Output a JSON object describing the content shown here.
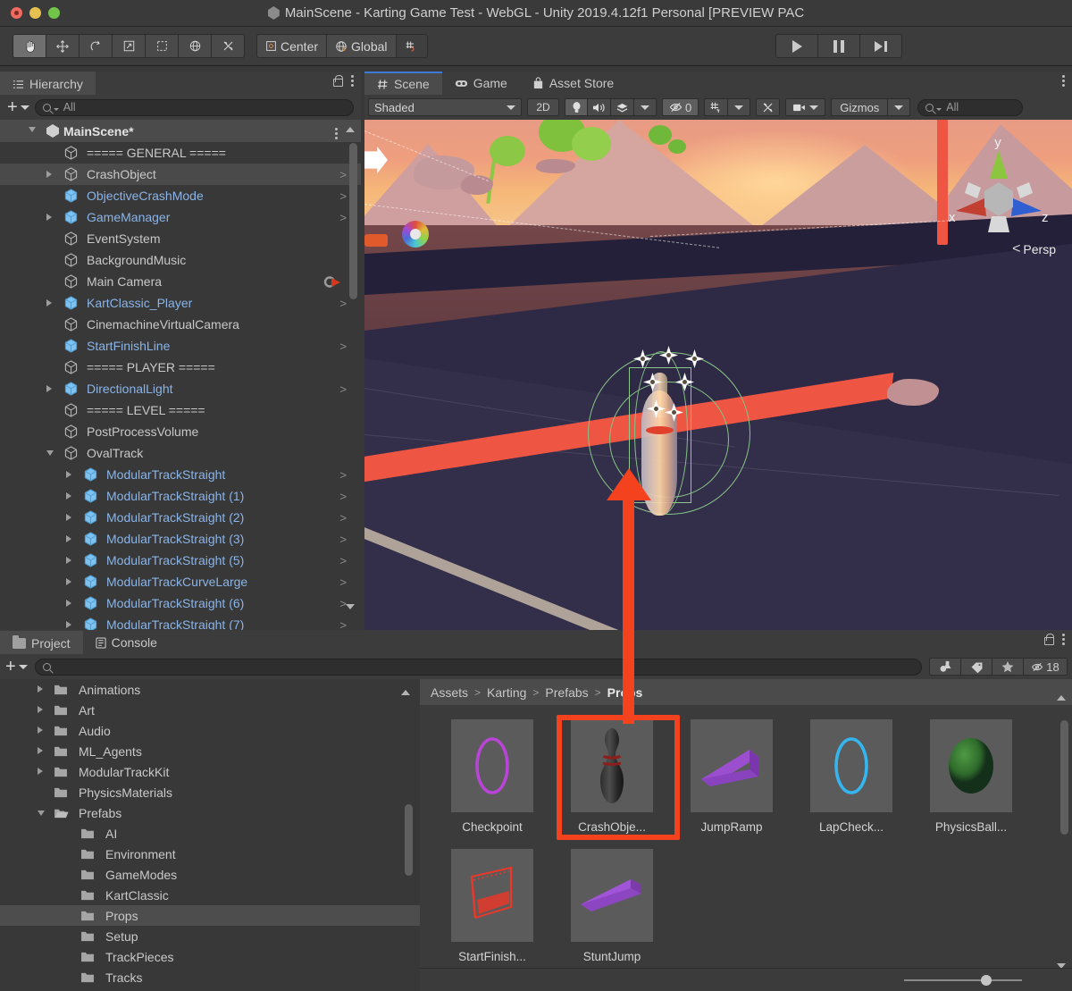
{
  "window": {
    "title": "MainScene - Karting Game Test - WebGL - Unity 2019.4.12f1 Personal [PREVIEW PAC",
    "traffic_close": "close-button",
    "traffic_minimize": "minimize-button",
    "traffic_zoom": "zoom-button"
  },
  "toolbar": {
    "tools": [
      {
        "name": "hand-tool",
        "glyph": "✋",
        "active": true
      },
      {
        "name": "move-tool",
        "glyph": "✥",
        "active": false
      },
      {
        "name": "rotate-tool",
        "glyph": "↻",
        "active": false
      },
      {
        "name": "scale-tool",
        "glyph": "⤡",
        "active": false
      },
      {
        "name": "rect-tool",
        "glyph": "⬚",
        "active": false
      },
      {
        "name": "transform-tool",
        "glyph": "✶",
        "active": false
      },
      {
        "name": "custom-tool",
        "glyph": "⚒",
        "active": false
      }
    ],
    "pivot_label": "Center",
    "handle_label": "Global",
    "grid_label": "grid-snap",
    "play_label": "play-button",
    "pause_label": "pause-button",
    "step_label": "step-button"
  },
  "hierarchy": {
    "tab_label": "Hierarchy",
    "search": {
      "value": "",
      "placeholder": "All"
    },
    "scene_name": "MainScene*",
    "items": [
      {
        "label": "===== GENERAL =====",
        "indent": 0,
        "prefab": false,
        "expandable": false,
        "chevron": false
      },
      {
        "label": "CrashObject",
        "indent": 0,
        "prefab": false,
        "expandable": true,
        "chevron": true,
        "selected": true
      },
      {
        "label": "ObjectiveCrashMode",
        "indent": 0,
        "prefab": true,
        "expandable": false,
        "chevron": true
      },
      {
        "label": "GameManager",
        "indent": 0,
        "prefab": true,
        "expandable": true,
        "chevron": true
      },
      {
        "label": "EventSystem",
        "indent": 0,
        "prefab": false,
        "expandable": false,
        "chevron": false
      },
      {
        "label": "BackgroundMusic",
        "indent": 0,
        "prefab": false,
        "expandable": false,
        "chevron": false
      },
      {
        "label": "Main Camera",
        "indent": 0,
        "prefab": false,
        "expandable": false,
        "chevron": false,
        "badge": true
      },
      {
        "label": "KartClassic_Player",
        "indent": 0,
        "prefab": true,
        "expandable": true,
        "chevron": true
      },
      {
        "label": "CinemachineVirtualCamera",
        "indent": 0,
        "prefab": false,
        "expandable": false,
        "chevron": false
      },
      {
        "label": "StartFinishLine",
        "indent": 0,
        "prefab": true,
        "expandable": false,
        "chevron": true
      },
      {
        "label": "===== PLAYER =====",
        "indent": 0,
        "prefab": false,
        "expandable": false,
        "chevron": false
      },
      {
        "label": "DirectionalLight",
        "indent": 0,
        "prefab": true,
        "expandable": true,
        "chevron": true
      },
      {
        "label": "===== LEVEL =====",
        "indent": 0,
        "prefab": false,
        "expandable": false,
        "chevron": false
      },
      {
        "label": "PostProcessVolume",
        "indent": 0,
        "prefab": false,
        "expandable": false,
        "chevron": false
      },
      {
        "label": "OvalTrack",
        "indent": 0,
        "prefab": false,
        "expandable": true,
        "expanded": true,
        "chevron": false
      },
      {
        "label": "ModularTrackStraight",
        "indent": 1,
        "prefab": true,
        "expandable": true,
        "chevron": true
      },
      {
        "label": "ModularTrackStraight (1)",
        "indent": 1,
        "prefab": true,
        "expandable": true,
        "chevron": true
      },
      {
        "label": "ModularTrackStraight (2)",
        "indent": 1,
        "prefab": true,
        "expandable": true,
        "chevron": true
      },
      {
        "label": "ModularTrackStraight (3)",
        "indent": 1,
        "prefab": true,
        "expandable": true,
        "chevron": true
      },
      {
        "label": "ModularTrackStraight (5)",
        "indent": 1,
        "prefab": true,
        "expandable": true,
        "chevron": true
      },
      {
        "label": "ModularTrackCurveLarge",
        "indent": 1,
        "prefab": true,
        "expandable": true,
        "chevron": true
      },
      {
        "label": "ModularTrackStraight (6)",
        "indent": 1,
        "prefab": true,
        "expandable": true,
        "chevron": true
      },
      {
        "label": "ModularTrackStraight (7)",
        "indent": 1,
        "prefab": true,
        "expandable": true,
        "chevron": true
      }
    ]
  },
  "sceneview": {
    "tabs": [
      {
        "label": "Scene",
        "icon": "hash-icon",
        "selected": true
      },
      {
        "label": "Game",
        "icon": "gamepad-icon",
        "selected": false
      },
      {
        "label": "Asset Store",
        "icon": "shop-bag-icon",
        "selected": false
      }
    ],
    "draw_mode": "Shaded",
    "two_d_label": "2D",
    "lighting_label": "lighting-toggle",
    "audio_label": "audio-toggle",
    "fx_label": "effects-dropdown",
    "hidden_count": "0",
    "grid_label": "grid-visibility",
    "component_tools_label": "component-tools",
    "camera_label": "scene-camera",
    "gizmos_label": "Gizmos",
    "search": {
      "value": "",
      "placeholder": "All"
    },
    "axis": {
      "x": "x",
      "y": "y",
      "z": "z"
    },
    "projection": "Persp"
  },
  "project": {
    "tabs": [
      {
        "label": "Project",
        "icon": "folder-icon",
        "selected": true
      },
      {
        "label": "Console",
        "icon": "console-icon",
        "selected": false
      }
    ],
    "search": {
      "value": "",
      "placeholder": ""
    },
    "hidden_count": "18",
    "folders": [
      {
        "label": "Animations",
        "indent": 1,
        "arrow": true
      },
      {
        "label": "Art",
        "indent": 1,
        "arrow": true
      },
      {
        "label": "Audio",
        "indent": 1,
        "arrow": true
      },
      {
        "label": "ML_Agents",
        "indent": 1,
        "arrow": true
      },
      {
        "label": "ModularTrackKit",
        "indent": 1,
        "arrow": true
      },
      {
        "label": "PhysicsMaterials",
        "indent": 1,
        "arrow": false
      },
      {
        "label": "Prefabs",
        "indent": 1,
        "arrow": true,
        "expanded": true,
        "open": true
      },
      {
        "label": "AI",
        "indent": 2,
        "arrow": false
      },
      {
        "label": "Environment",
        "indent": 2,
        "arrow": false
      },
      {
        "label": "GameModes",
        "indent": 2,
        "arrow": false
      },
      {
        "label": "KartClassic",
        "indent": 2,
        "arrow": false
      },
      {
        "label": "Props",
        "indent": 2,
        "arrow": false,
        "selected": true
      },
      {
        "label": "Setup",
        "indent": 2,
        "arrow": false
      },
      {
        "label": "TrackPieces",
        "indent": 2,
        "arrow": false
      },
      {
        "label": "Tracks",
        "indent": 2,
        "arrow": false
      }
    ],
    "breadcrumb": [
      "Assets",
      "Karting",
      "Prefabs",
      "Props"
    ],
    "assets": [
      {
        "label": "Checkpoint",
        "thumb": "torus-magenta",
        "highlighted": false
      },
      {
        "label": "CrashObje...",
        "thumb": "bowling-pin",
        "highlighted": true
      },
      {
        "label": "JumpRamp",
        "thumb": "ramp-purple",
        "highlighted": false
      },
      {
        "label": "LapCheck...",
        "thumb": "torus-cyan",
        "highlighted": false
      },
      {
        "label": "PhysicsBall...",
        "thumb": "sphere-green",
        "highlighted": false
      },
      {
        "label": "StartFinish...",
        "thumb": "startline-red",
        "highlighted": false
      },
      {
        "label": "StuntJump",
        "thumb": "slab-purple",
        "highlighted": false
      }
    ]
  },
  "annotation": {
    "highlight_color": "#f4411e",
    "target_asset": "CrashObje...",
    "points_to": "scene-crash-object"
  }
}
